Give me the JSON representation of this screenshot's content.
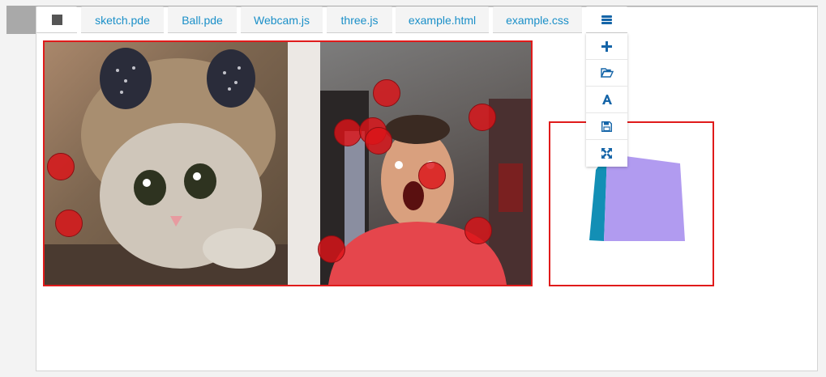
{
  "tabs": {
    "stop": {
      "icon": "stop-icon"
    },
    "files": [
      {
        "label": "sketch.pde"
      },
      {
        "label": "Ball.pde"
      },
      {
        "label": "Webcam.js"
      },
      {
        "label": "three.js"
      },
      {
        "label": "example.html"
      },
      {
        "label": "example.css"
      }
    ],
    "menu": {
      "icon": "hamburger-menu-icon"
    }
  },
  "menu_dropdown": [
    {
      "action": "new-file",
      "icon": "plus-icon"
    },
    {
      "action": "open-file",
      "icon": "folder-open-icon"
    },
    {
      "action": "font",
      "icon": "font-icon"
    },
    {
      "action": "save",
      "icon": "floppy-disk-icon"
    },
    {
      "action": "fullscreen",
      "icon": "expand-icon"
    }
  ],
  "sketch_output": {
    "border_color": "#e01b1b",
    "images": [
      "kitten-photo",
      "webcam-feed"
    ],
    "ball_color": "#dc1419"
  },
  "three_preview": {
    "border_color": "#e01b1b",
    "cube_front_color": "#b19bf0",
    "cube_side_color": "#138fb5"
  },
  "colors": {
    "tab_text": "#1a8fc8",
    "topbar": "#a9a9a9",
    "menu_icon": "#1565a8"
  }
}
